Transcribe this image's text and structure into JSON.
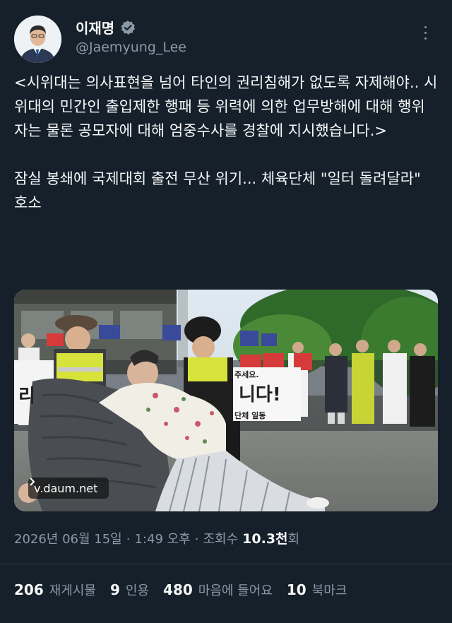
{
  "author": {
    "name": "이재명",
    "handle": "@Jaemyung_Lee",
    "verified": true
  },
  "tweet": {
    "paragraph1": "<시위대는 의사표현을 넘어 타인의 권리침해가 없도록 자제해야.. 시위대의 민간인 출입제한 행패 등 위력에 의한 업무방해에 대해 행위자는 물론 공모자에 대해 엄중수사를 경찰에 지시했습니다.>",
    "paragraph2": "잠실 봉쇄에 국제대회 출전 무산 위기... 체육단체 \"일터 돌려달라\" 호소"
  },
  "media": {
    "source": "v.daum.net",
    "banner_text": "니다!",
    "banner_left_text": "리",
    "sign_text": "주세요.",
    "sign_sub": "단체 일동"
  },
  "meta": {
    "date": "2026년 06월 15일",
    "time": "1:49 오후",
    "views_label": "조회수",
    "views_count": "10.3천",
    "views_suffix": "회",
    "separator": "·"
  },
  "stats": {
    "retweets_count": "206",
    "retweets_label": "재게시물",
    "quotes_count": "9",
    "quotes_label": "인용",
    "likes_count": "480",
    "likes_label": "마음에 들어요",
    "bookmarks_count": "10",
    "bookmarks_label": "북마크"
  },
  "colors": {
    "background": "#15202b",
    "text": "#f7f9f9",
    "secondary": "#8b98a5",
    "divider": "#38444d"
  }
}
